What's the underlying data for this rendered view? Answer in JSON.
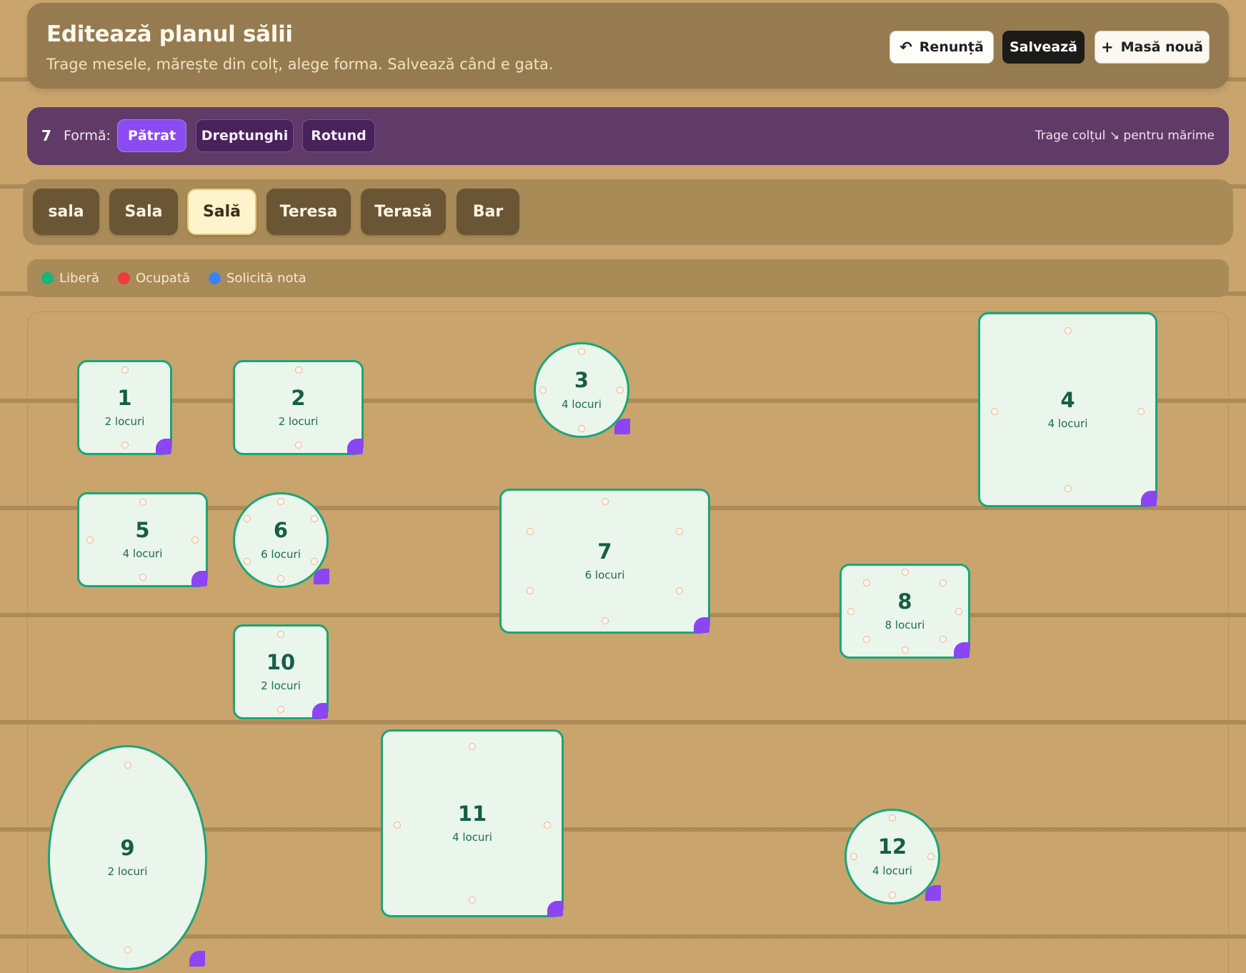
{
  "header": {
    "title": "Editează planul sălii",
    "subtitle": "Trage mesele, mărește din colț, alege forma. Salvează când e gata.",
    "cancel_label": "Renunță",
    "save_label": "Salvează",
    "new_table_label": "Masă nouă"
  },
  "shape_bar": {
    "selected_table": "7",
    "form_label": "Formă:",
    "options": [
      "Pătrat",
      "Dreptunghi",
      "Rotund"
    ],
    "active_option": "Pătrat",
    "hint": "Trage colțul ↘ pentru mărime"
  },
  "rooms": {
    "tabs": [
      "sala",
      "Sala",
      "Sală",
      "Teresa",
      "Terasă",
      "Bar"
    ],
    "active": "Sală"
  },
  "legend": {
    "items": [
      {
        "label": "Liberă",
        "color": "#16b67c"
      },
      {
        "label": "Ocupată",
        "color": "#ef3b3b"
      },
      {
        "label": "Solicită nota",
        "color": "#3b82f6"
      }
    ]
  },
  "colors": {
    "table_fill": "#eaf5ec",
    "table_border": "#1aa677",
    "resize_handle": "#8b45f2",
    "accent": "#8a4cf0"
  },
  "tables": [
    {
      "number": "1",
      "seats": "2 locuri",
      "shape": "square"
    },
    {
      "number": "2",
      "seats": "2 locuri",
      "shape": "square"
    },
    {
      "number": "3",
      "seats": "4 locuri",
      "shape": "round"
    },
    {
      "number": "4",
      "seats": "4 locuri",
      "shape": "square"
    },
    {
      "number": "5",
      "seats": "4 locuri",
      "shape": "square"
    },
    {
      "number": "6",
      "seats": "6 locuri",
      "shape": "round"
    },
    {
      "number": "7",
      "seats": "6 locuri",
      "shape": "square"
    },
    {
      "number": "8",
      "seats": "8 locuri",
      "shape": "square"
    },
    {
      "number": "10",
      "seats": "2 locuri",
      "shape": "square"
    },
    {
      "number": "9",
      "seats": "2 locuri",
      "shape": "oval"
    },
    {
      "number": "11",
      "seats": "4 locuri",
      "shape": "square"
    },
    {
      "number": "12",
      "seats": "4 locuri",
      "shape": "round"
    }
  ]
}
